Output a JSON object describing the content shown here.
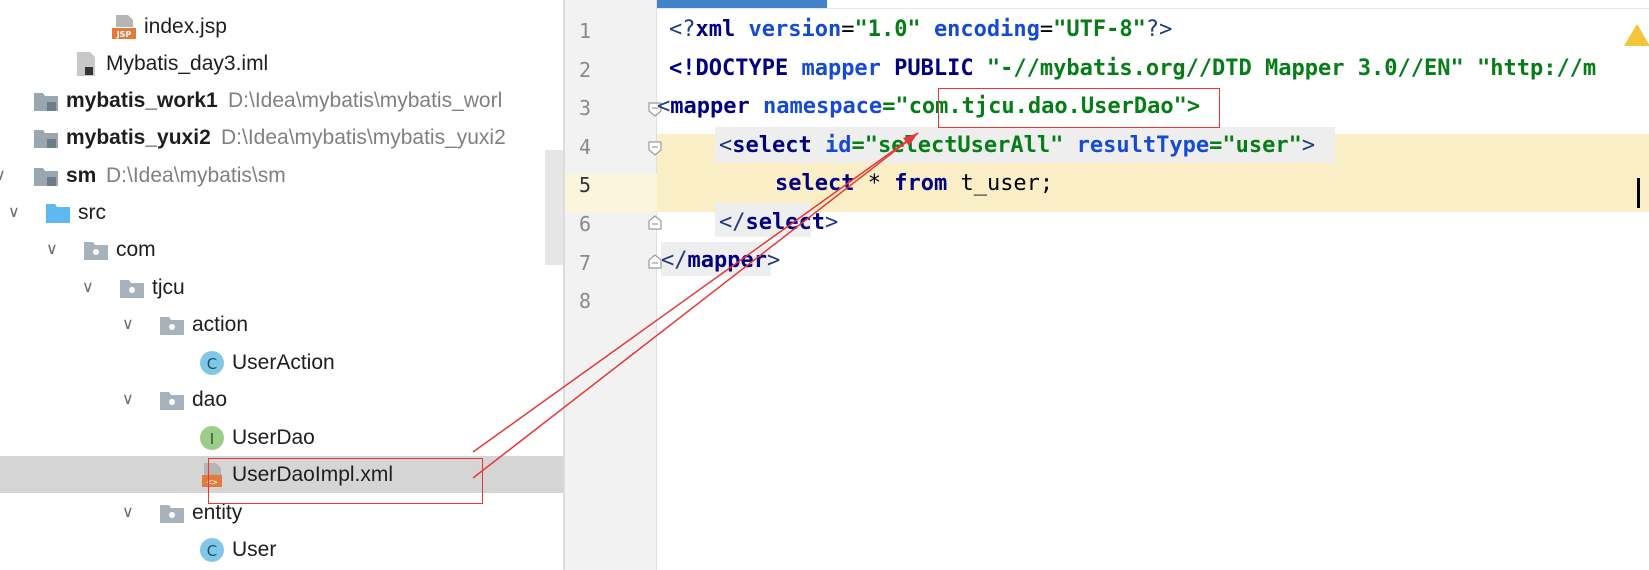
{
  "project_tree": {
    "items": [
      {
        "label": "index.jsp",
        "icon": "jsp-file-icon",
        "bold": false
      },
      {
        "label": "Mybatis_day3.iml",
        "icon": "iml-file-icon",
        "bold": false
      },
      {
        "label": "mybatis_work1",
        "path": "D:\\Idea\\mybatis\\mybatis_worl",
        "icon": "module-folder-icon",
        "bold": true,
        "expander": "collapsed"
      },
      {
        "label": "mybatis_yuxi2",
        "path": "D:\\Idea\\mybatis\\mybatis_yuxi2",
        "icon": "module-folder-icon",
        "bold": true,
        "expander": "collapsed"
      },
      {
        "label": "sm",
        "path": "D:\\Idea\\mybatis\\sm",
        "icon": "module-folder-icon",
        "bold": true,
        "expander": "expanded"
      },
      {
        "label": "src",
        "icon": "source-folder-icon",
        "bold": false,
        "expander": "expanded"
      },
      {
        "label": "com",
        "icon": "package-icon",
        "bold": false,
        "expander": "expanded"
      },
      {
        "label": "tjcu",
        "icon": "package-icon",
        "bold": false,
        "expander": "expanded"
      },
      {
        "label": "action",
        "icon": "package-icon",
        "bold": false,
        "expander": "expanded"
      },
      {
        "label": "UserAction",
        "icon": "class-icon",
        "icon_letter": "C",
        "bold": false
      },
      {
        "label": "dao",
        "icon": "package-icon",
        "bold": false,
        "expander": "expanded"
      },
      {
        "label": "UserDao",
        "icon": "interface-icon",
        "icon_letter": "I",
        "bold": false
      },
      {
        "label": "UserDaoImpl.xml",
        "icon": "xml-file-icon",
        "bold": false,
        "selected": true
      },
      {
        "label": "entity",
        "icon": "package-icon",
        "bold": false,
        "expander": "expanded"
      },
      {
        "label": "User",
        "icon": "class-icon",
        "icon_letter": "C",
        "bold": false
      }
    ],
    "jsp_icon_text": "JSP"
  },
  "editor": {
    "line_numbers": [
      "1",
      "2",
      "3",
      "4",
      "5",
      "6",
      "7",
      "8"
    ],
    "current_line": "5",
    "lines": {
      "l1": {
        "p1": "<?",
        "p2": "xml ",
        "p3": "version",
        "p4": "=",
        "p5": "\"1.0\"",
        "p6": " ",
        "p7": "encoding",
        "p8": "=",
        "p9": "\"UTF-8\"",
        "p10": "?>"
      },
      "l2": {
        "p1": "<!DOCTYPE ",
        "p2": "mapper ",
        "p3": "PUBLIC ",
        "p4": "\"-//mybatis.org//DTD Mapper 3.0//EN\"",
        "p5": " ",
        "p6": "\"http://m"
      },
      "l3": {
        "p1": "<",
        "p2": "mapper ",
        "p3": "namespace",
        "p4": "=\"",
        "p5": "com.tjcu.dao.UserDao",
        "p6": "\">"
      },
      "l4": {
        "p1": "<",
        "p2": "select ",
        "p3": "id",
        "p4": "=",
        "p5": "\"selectUserAll\"",
        "p6": " ",
        "p7": "resultType",
        "p8": "=",
        "p9": "\"user\"",
        "p10": ">"
      },
      "l5": {
        "p1": "select ",
        "p2": "* ",
        "p3": "from ",
        "p4": "t_user;"
      },
      "l6": {
        "p1": "</",
        "p2": "select",
        "p3": ">"
      },
      "l7": {
        "p1": "</",
        "p2": "mapper",
        "p3": ">"
      }
    }
  },
  "colors": {
    "tag": "#000080",
    "string": "#067d17",
    "attribute": "#174ad4",
    "annotation": "#e53935",
    "selection": "#d5d5d5",
    "current_line": "#fcf5de"
  }
}
